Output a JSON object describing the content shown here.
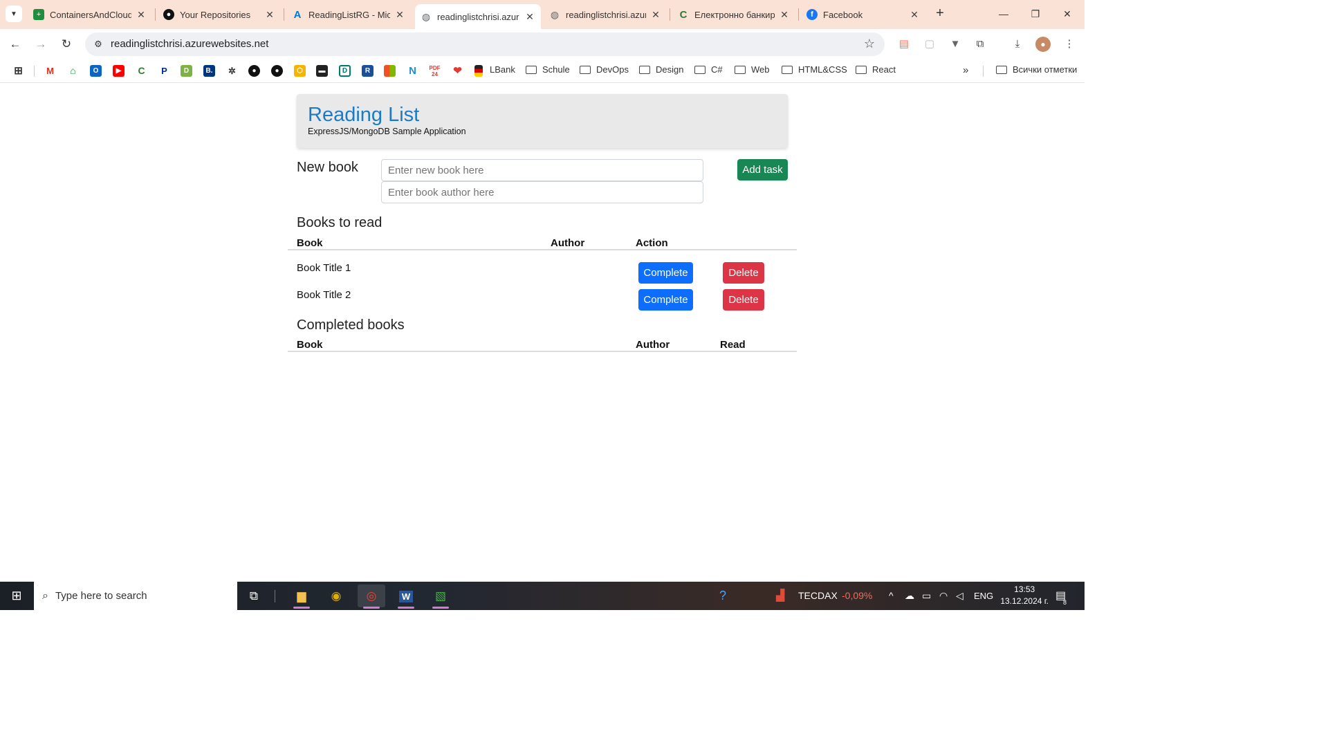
{
  "browser": {
    "tabs": [
      {
        "title": "ContainersAndCloud",
        "favicon": "sheets-icon",
        "color": "#1e8e3e"
      },
      {
        "title": "Your Repositories",
        "favicon": "github-icon",
        "color": "#111111"
      },
      {
        "title": "ReadingListRG - Micr",
        "favicon": "azure-icon",
        "color": "#0078d4"
      },
      {
        "title": "readinglistchrisi.azur",
        "favicon": "globe-icon",
        "color": "#5f6368"
      },
      {
        "title": "readinglistchrisi.azur",
        "favicon": "globe-icon",
        "color": "#5f6368"
      },
      {
        "title": "Електронно банкир",
        "favicon": "bank-icon",
        "color": "#2e7d32"
      },
      {
        "title": "Facebook",
        "favicon": "facebook-icon",
        "color": "#1877f2"
      }
    ],
    "url": "readinglistchrisi.azurewebsites.net",
    "bookmark_folders": [
      "LBank",
      "Schule",
      "DevOps",
      "Design",
      "C#",
      "Web",
      "HTML&CSS",
      "React"
    ],
    "all_bookmarks": "Всички отметки"
  },
  "app": {
    "title": "Reading List",
    "subtitle": "ExpressJS/MongoDB Sample Application",
    "new_book_label": "New book",
    "title_placeholder": "Enter new book here",
    "author_placeholder": "Enter book author here",
    "add_button": "Add task",
    "to_read_heading": "Books to read",
    "to_read_columns": {
      "book": "Book",
      "author": "Author",
      "action": "Action"
    },
    "books": [
      {
        "title": "Book Title 1",
        "author": ""
      },
      {
        "title": "Book Title 2",
        "author": ""
      }
    ],
    "complete_label": "Complete",
    "delete_label": "Delete",
    "completed_heading": "Completed books",
    "completed_columns": {
      "book": "Book",
      "author": "Author",
      "read": "Read"
    }
  },
  "taskbar": {
    "search_placeholder": "Type here to search",
    "ticker_name": "TECDAX",
    "ticker_change": "-0,09%",
    "language": "ENG",
    "time": "13:53",
    "date": "13.12.2024 г.",
    "notifications_count": "8"
  }
}
